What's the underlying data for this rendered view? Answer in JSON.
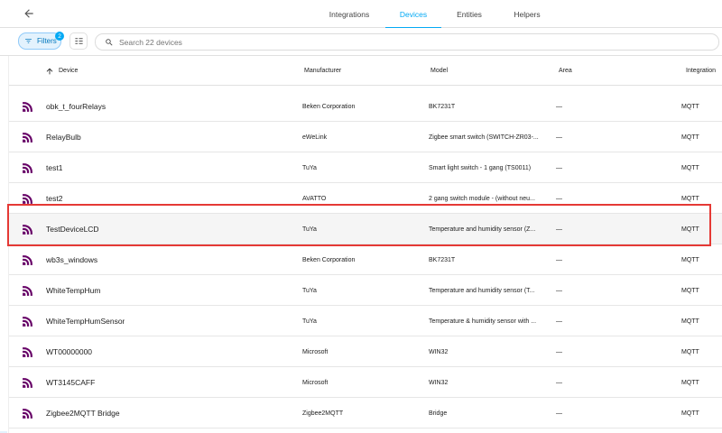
{
  "tabs": [
    {
      "label": "Integrations",
      "active": false
    },
    {
      "label": "Devices",
      "active": true
    },
    {
      "label": "Entities",
      "active": false
    },
    {
      "label": "Helpers",
      "active": false
    }
  ],
  "toolbar": {
    "filters_label": "Filters",
    "filters_count": "2",
    "search_placeholder": "Search 22 devices"
  },
  "table": {
    "columns": {
      "device": "Device",
      "manufacturer": "Manufacturer",
      "model": "Model",
      "area": "Area",
      "integration": "Integration"
    },
    "rows": [
      {
        "name": "obk_t_fourRelays",
        "manufacturer": "Beken Corporation",
        "model": "BK7231T",
        "area": "—",
        "integration": "MQTT"
      },
      {
        "name": "RelayBulb",
        "manufacturer": "eWeLink",
        "model": "Zigbee smart switch (SWITCH-ZR03-...",
        "area": "—",
        "integration": "MQTT"
      },
      {
        "name": "test1",
        "manufacturer": "TuYa",
        "model": "Smart light switch - 1 gang (TS0011)",
        "area": "—",
        "integration": "MQTT"
      },
      {
        "name": "test2",
        "manufacturer": "AVATTO",
        "model": "2 gang switch module - (without neu...",
        "area": "—",
        "integration": "MQTT"
      },
      {
        "name": "TestDeviceLCD",
        "manufacturer": "TuYa",
        "model": "Temperature and humidity sensor (Z...",
        "area": "—",
        "integration": "MQTT"
      },
      {
        "name": "wb3s_windows",
        "manufacturer": "Beken Corporation",
        "model": "BK7231T",
        "area": "—",
        "integration": "MQTT"
      },
      {
        "name": "WhiteTempHum",
        "manufacturer": "TuYa",
        "model": "Temperature and humidity sensor (T...",
        "area": "—",
        "integration": "MQTT"
      },
      {
        "name": "WhiteTempHumSensor",
        "manufacturer": "TuYa",
        "model": "Temperature & humidity sensor with ...",
        "area": "—",
        "integration": "MQTT"
      },
      {
        "name": "WT00000000",
        "manufacturer": "Microsoft",
        "model": "WIN32",
        "area": "—",
        "integration": "MQTT"
      },
      {
        "name": "WT3145CAFF",
        "manufacturer": "Microsoft",
        "model": "WIN32",
        "area": "—",
        "integration": "MQTT"
      },
      {
        "name": "Zigbee2MQTT Bridge",
        "manufacturer": "Zigbee2MQTT",
        "model": "Bridge",
        "area": "—",
        "integration": "MQTT"
      }
    ]
  },
  "icons": {
    "row_icon": "mqtt-icon",
    "row_icon_color": "#660066",
    "accent": "#03a9f4",
    "highlight_color": "#e53935"
  }
}
